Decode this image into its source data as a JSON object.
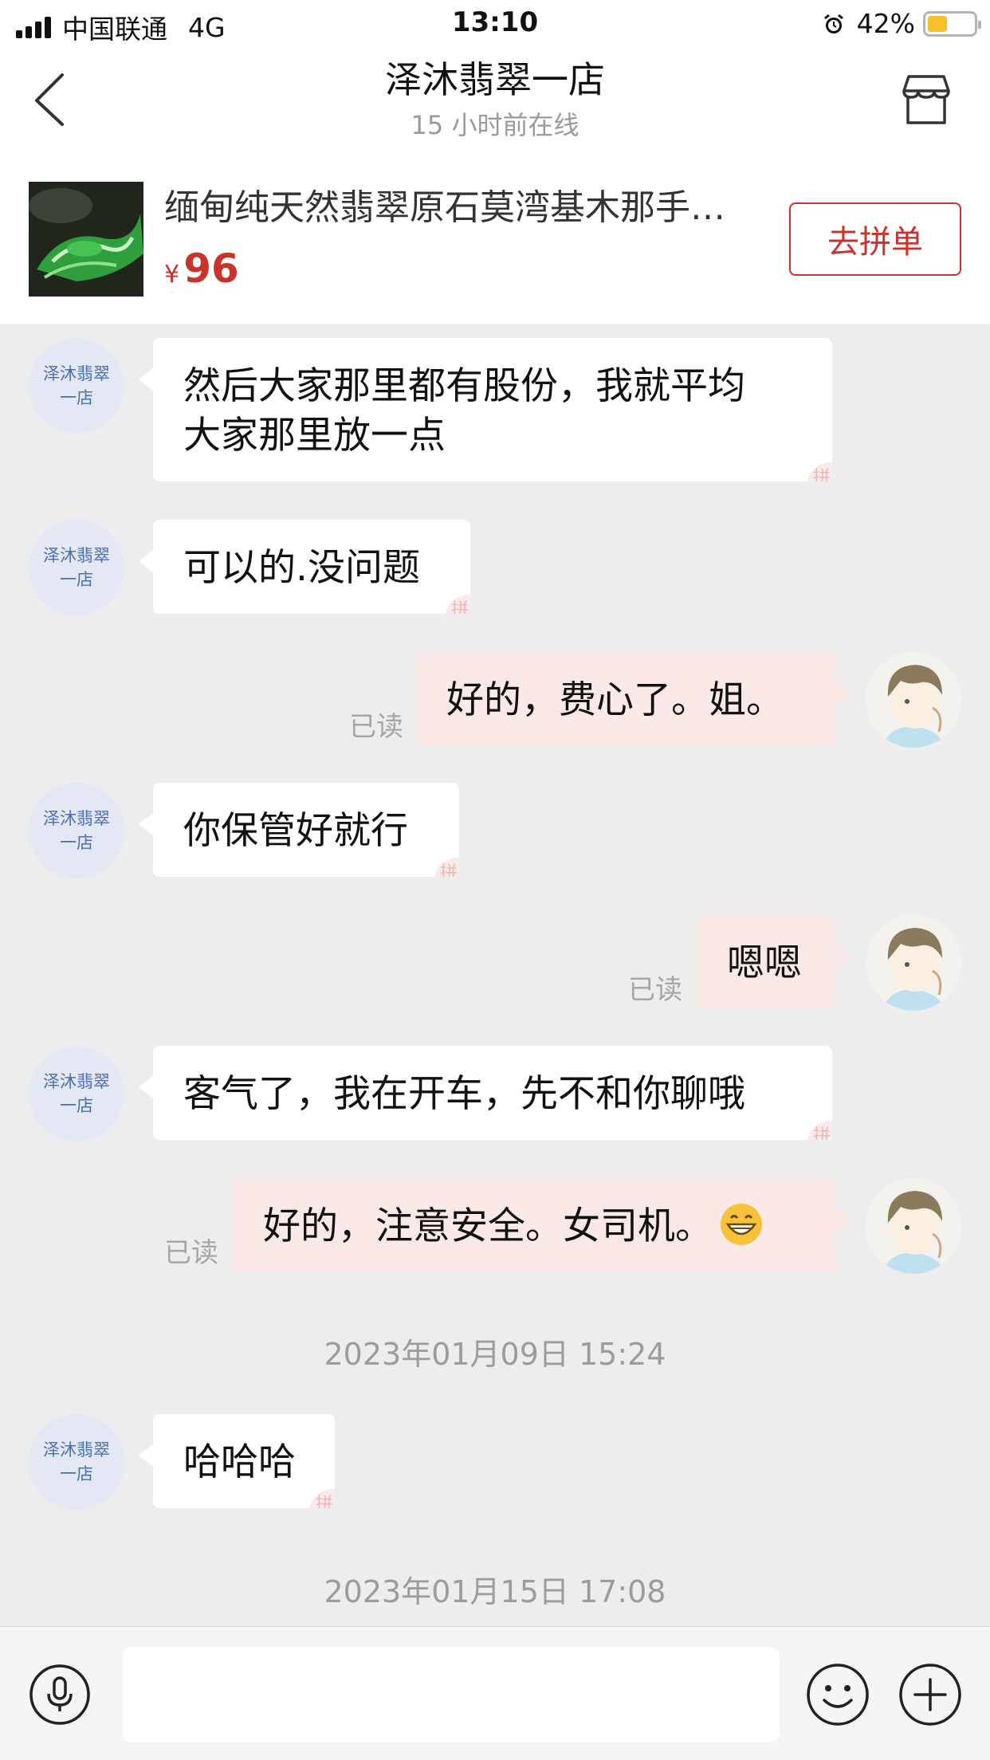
{
  "status_bar": {
    "carrier": "中国联通",
    "network": "4G",
    "time": "13:10",
    "battery": "42%",
    "battery_level": 0.42
  },
  "nav": {
    "title": "泽沐翡翠一店",
    "subtitle": "15 小时前在线"
  },
  "product": {
    "title": "缅甸纯天然翡翠原石莫湾基木那手…",
    "currency": "¥",
    "price": "96",
    "action": "去拼单"
  },
  "shop_avatar": {
    "line1": "泽沐翡翠",
    "line2": "一店"
  },
  "messages": [
    {
      "from": "shop",
      "text_line1": "然后大家那里都有股份，我就平均",
      "text_line2": "大家那里放一点"
    },
    {
      "from": "shop",
      "text": "可以的.没问题"
    },
    {
      "from": "me",
      "text": "好的，费心了。姐。",
      "status": "已读"
    },
    {
      "from": "shop",
      "text": "你保管好就行"
    },
    {
      "from": "me",
      "text": "嗯嗯",
      "status": "已读"
    },
    {
      "from": "shop",
      "text": "客气了，我在开车，先不和你聊哦"
    },
    {
      "from": "me",
      "text": "好的，注意安全。女司机。",
      "emoji": "grinning-face",
      "status": "已读"
    },
    {
      "from": "shop",
      "text": "哈哈哈"
    }
  ],
  "timestamps": [
    "2023年01月09日 15:24",
    "2023年01月15日 17:08"
  ],
  "input_bar": {
    "placeholder": ""
  },
  "colors": {
    "accent": "#c8332c",
    "outgoing_bubble": "#fbe9e8",
    "chat_bg": "#ededed"
  }
}
